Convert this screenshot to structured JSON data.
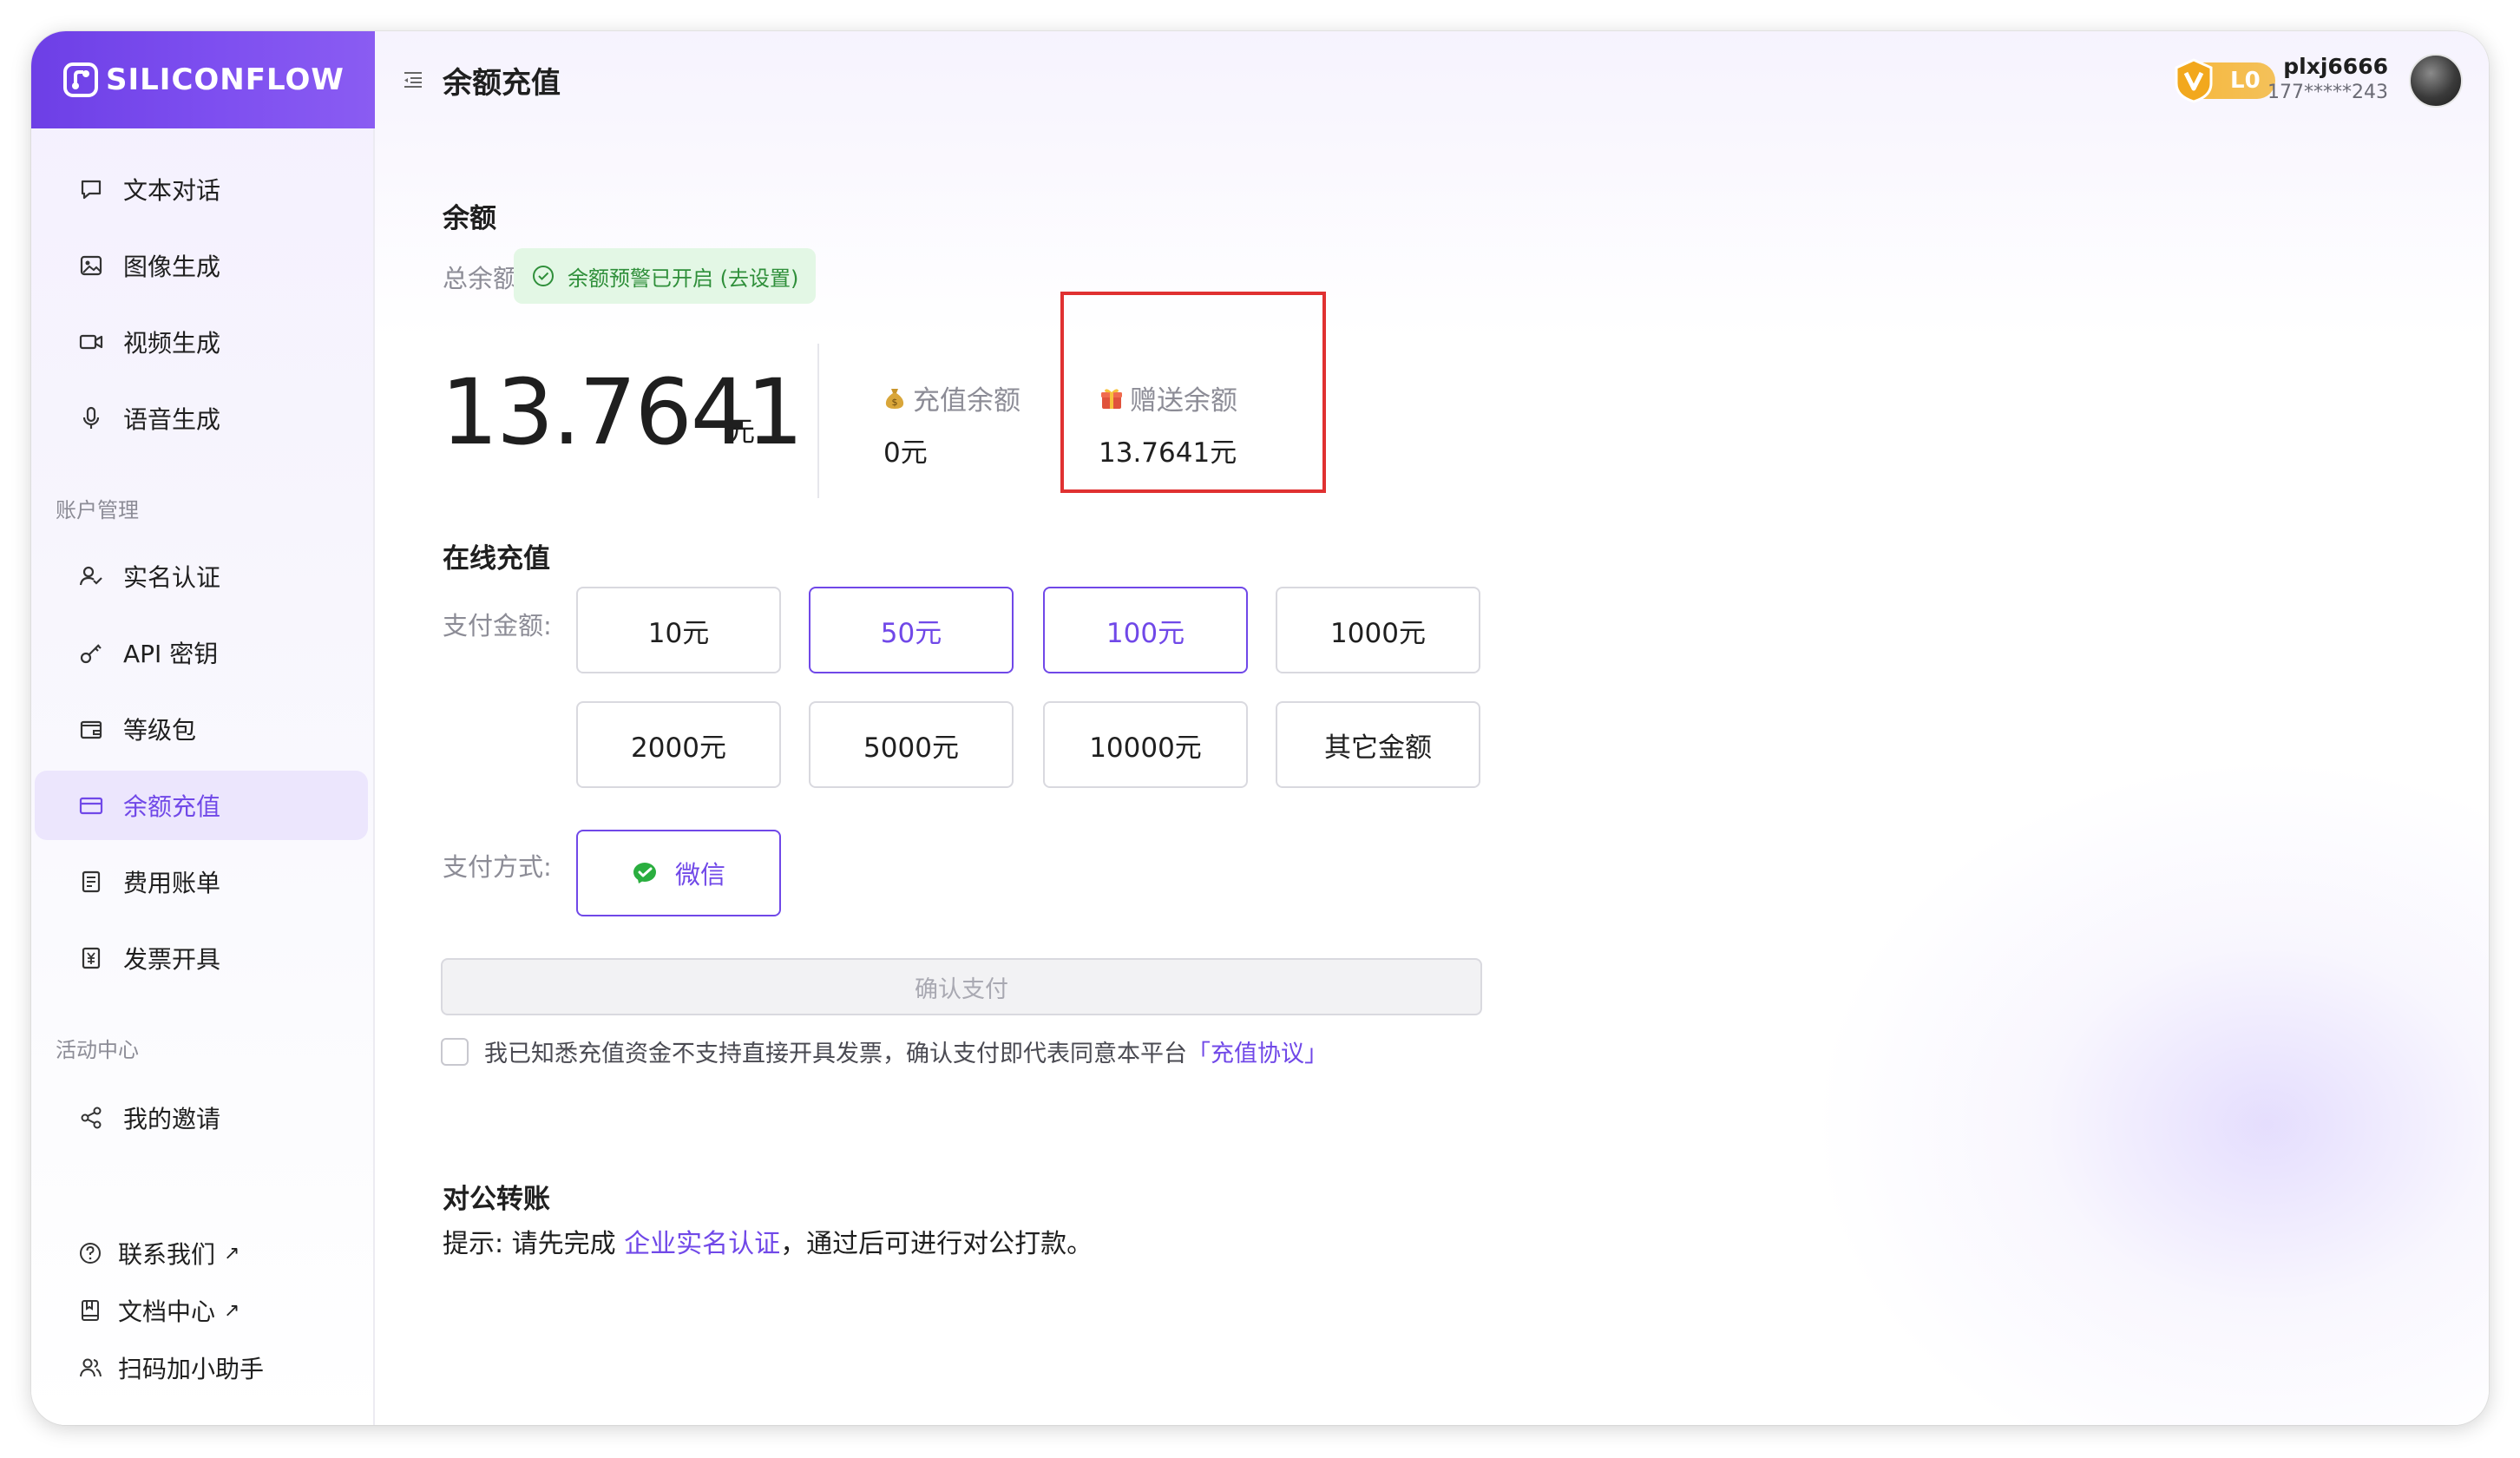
{
  "brand": {
    "logo_text": "SILICONFLOW"
  },
  "header": {
    "page_title": "余额充值",
    "vip_level": "L0",
    "username": "plxj6666",
    "phone": "177*****243"
  },
  "sidebar": {
    "top_items": [
      {
        "label": "文本对话",
        "icon": "chat-icon"
      },
      {
        "label": "图像生成",
        "icon": "image-icon"
      },
      {
        "label": "视频生成",
        "icon": "video-icon"
      },
      {
        "label": "语音生成",
        "icon": "mic-icon"
      }
    ],
    "account_group": "账户管理",
    "account_items": [
      {
        "label": "实名认证",
        "icon": "user-check-icon"
      },
      {
        "label": "API 密钥",
        "icon": "key-icon"
      },
      {
        "label": "等级包",
        "icon": "wallet-icon"
      },
      {
        "label": "余额充值",
        "icon": "card-icon",
        "active": true
      },
      {
        "label": "费用账单",
        "icon": "bill-icon"
      },
      {
        "label": "发票开具",
        "icon": "invoice-icon"
      }
    ],
    "activity_group": "活动中心",
    "activity_items": [
      {
        "label": "我的邀请",
        "icon": "share-icon"
      }
    ],
    "bottom_items": [
      {
        "label": "联系我们",
        "external": "↗"
      },
      {
        "label": "文档中心",
        "external": "↗"
      },
      {
        "label": "扫码加小助手"
      }
    ]
  },
  "balance": {
    "section_title": "余额",
    "total_label": "总余额",
    "alert_text": "余额预警已开启 (去设置)",
    "total_value": "13.7641",
    "unit": "元",
    "recharge_label": "充值余额",
    "recharge_value": "0元",
    "gift_label": "赠送余额",
    "gift_value": "13.7641元"
  },
  "recharge": {
    "section_title": "在线充值",
    "amount_label": "支付金额:",
    "amounts": [
      "10元",
      "50元",
      "100元",
      "1000元",
      "2000元",
      "5000元",
      "10000元",
      "其它金额"
    ],
    "method_label": "支付方式:",
    "method": "微信",
    "confirm_label": "确认支付",
    "agree_text": "我已知悉充值资金不支持直接开具发票，确认支付即代表同意本平台",
    "agree_link": "「充值协议」"
  },
  "transfer": {
    "section_title": "对公转账",
    "tip_prefix": "提示: 请先完成 ",
    "tip_link": "企业实名认证",
    "tip_suffix": "，通过后可进行对公打款。"
  },
  "colors": {
    "accent": "#7048e8",
    "highlight": "#e03131",
    "success": "#2f8f3a"
  }
}
